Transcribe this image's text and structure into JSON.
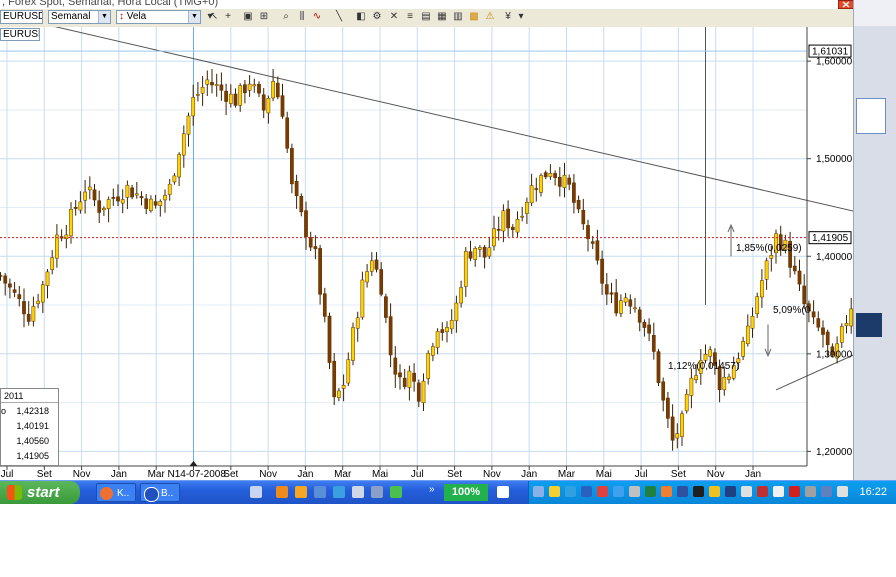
{
  "window": {
    "title": ", Forex Spot, Semanal, Hora Local (TMG+0)"
  },
  "toolbar": {
    "symbol_combo": "EURUSD",
    "period_combo": "Semanal",
    "chart_type_combo": "Vela",
    "instrument_label": "EURUSD"
  },
  "chart_data": {
    "type": "candlestick",
    "title": "",
    "xlabel": "",
    "ylabel": "",
    "ylim": [
      1.185,
      1.635
    ],
    "grid": true,
    "y_ticks": [
      "1,60000",
      "1,50000",
      "1,40000",
      "1,30000",
      "1,20000"
    ],
    "y_tick_values": [
      1.6,
      1.5,
      1.4,
      1.3,
      1.2
    ],
    "x_ticks": [
      "Jul",
      "Set",
      "Nov",
      "Jan",
      "Mar",
      "N14-07-2008",
      "Set",
      "Nov",
      "Jan",
      "Mar",
      "Mai",
      "Jul",
      "Set",
      "Nov",
      "Jan",
      "Mar",
      "Mai",
      "Jul",
      "Set",
      "Nov",
      "Jan"
    ],
    "crosshair_date": "N14-07-2008",
    "high_price_label": "1,61031",
    "high_price_value": 1.61031,
    "current_price_label": "1,41905",
    "current_price_value": 1.41905,
    "annotations": [
      {
        "text": "1,85%(0,0259)",
        "price": 1.4087
      },
      {
        "text": "5,09%(0",
        "price": 1.345
      },
      {
        "text": "1,12%(0,01457)",
        "price": 1.2875
      }
    ],
    "trendlines": [
      {
        "name": "resistance",
        "from": {
          "week": -6,
          "price": 1.655
        },
        "to": {
          "week": 199,
          "price": 1.4268
        }
      },
      {
        "name": "support",
        "from": {
          "week": 165,
          "price": 1.263
        },
        "to": {
          "week": 205,
          "price": 1.35
        }
      }
    ],
    "vertical_marker_week": 150,
    "anchor_points": [
      [
        0,
        1.38
      ],
      [
        3,
        1.36
      ],
      [
        6,
        1.34
      ],
      [
        9,
        1.37
      ],
      [
        12,
        1.42
      ],
      [
        14,
        1.43
      ],
      [
        18,
        1.47
      ],
      [
        21,
        1.45
      ],
      [
        24,
        1.46
      ],
      [
        27,
        1.47
      ],
      [
        30,
        1.46
      ],
      [
        33,
        1.45
      ],
      [
        36,
        1.47
      ],
      [
        38,
        1.51
      ],
      [
        41,
        1.56
      ],
      [
        44,
        1.58
      ],
      [
        47,
        1.57
      ],
      [
        50,
        1.56
      ],
      [
        53,
        1.58
      ],
      [
        56,
        1.55
      ],
      [
        58,
        1.58
      ],
      [
        60,
        1.55
      ],
      [
        62,
        1.47
      ],
      [
        64,
        1.44
      ],
      [
        67,
        1.4
      ],
      [
        69,
        1.33
      ],
      [
        71,
        1.25
      ],
      [
        73,
        1.27
      ],
      [
        75,
        1.32
      ],
      [
        77,
        1.37
      ],
      [
        79,
        1.4
      ],
      [
        81,
        1.37
      ],
      [
        83,
        1.3
      ],
      [
        85,
        1.27
      ],
      [
        87,
        1.28
      ],
      [
        89,
        1.26
      ],
      [
        91,
        1.3
      ],
      [
        93,
        1.33
      ],
      [
        95,
        1.32
      ],
      [
        97,
        1.35
      ],
      [
        99,
        1.4
      ],
      [
        101,
        1.41
      ],
      [
        103,
        1.4
      ],
      [
        105,
        1.42
      ],
      [
        107,
        1.44
      ],
      [
        109,
        1.43
      ],
      [
        111,
        1.45
      ],
      [
        113,
        1.47
      ],
      [
        115,
        1.48
      ],
      [
        117,
        1.49
      ],
      [
        119,
        1.48
      ],
      [
        121,
        1.47
      ],
      [
        123,
        1.44
      ],
      [
        125,
        1.42
      ],
      [
        127,
        1.39
      ],
      [
        129,
        1.36
      ],
      [
        131,
        1.35
      ],
      [
        133,
        1.36
      ],
      [
        135,
        1.35
      ],
      [
        137,
        1.33
      ],
      [
        139,
        1.3
      ],
      [
        141,
        1.25
      ],
      [
        143,
        1.21
      ],
      [
        145,
        1.23
      ],
      [
        147,
        1.27
      ],
      [
        149,
        1.3
      ],
      [
        151,
        1.3
      ],
      [
        153,
        1.27
      ],
      [
        155,
        1.28
      ],
      [
        157,
        1.3
      ],
      [
        159,
        1.32
      ],
      [
        161,
        1.36
      ],
      [
        163,
        1.39
      ],
      [
        165,
        1.42
      ],
      [
        167,
        1.41
      ],
      [
        169,
        1.38
      ],
      [
        171,
        1.35
      ],
      [
        173,
        1.33
      ],
      [
        175,
        1.32
      ],
      [
        177,
        1.29
      ],
      [
        179,
        1.32
      ],
      [
        181,
        1.35
      ],
      [
        183,
        1.37
      ],
      [
        185,
        1.38
      ],
      [
        187,
        1.4
      ],
      [
        189,
        1.41
      ],
      [
        191,
        1.419
      ]
    ]
  },
  "info_box": {
    "date": "2011",
    "rows": [
      {
        "label": "o",
        "value": "1,42318"
      },
      {
        "label": "",
        "value": "1,40191"
      },
      {
        "label": "",
        "value": "1,40560"
      },
      {
        "label": "",
        "value": "1,41905"
      }
    ]
  },
  "taskbar": {
    "start_label": "start",
    "task1_label": "K..",
    "task2_label": "B..",
    "zoom_label": "100%",
    "clock": "16:22"
  },
  "colors": {
    "bull_candle": "#ffd200",
    "bear_candle": "#7a3b00",
    "grid": "#c6dcf2",
    "price_line": "#d11a1a",
    "taskbar_blue": "#245edb",
    "tray_blue": "#0c9ff0",
    "start_green": "#3a9a3a"
  }
}
